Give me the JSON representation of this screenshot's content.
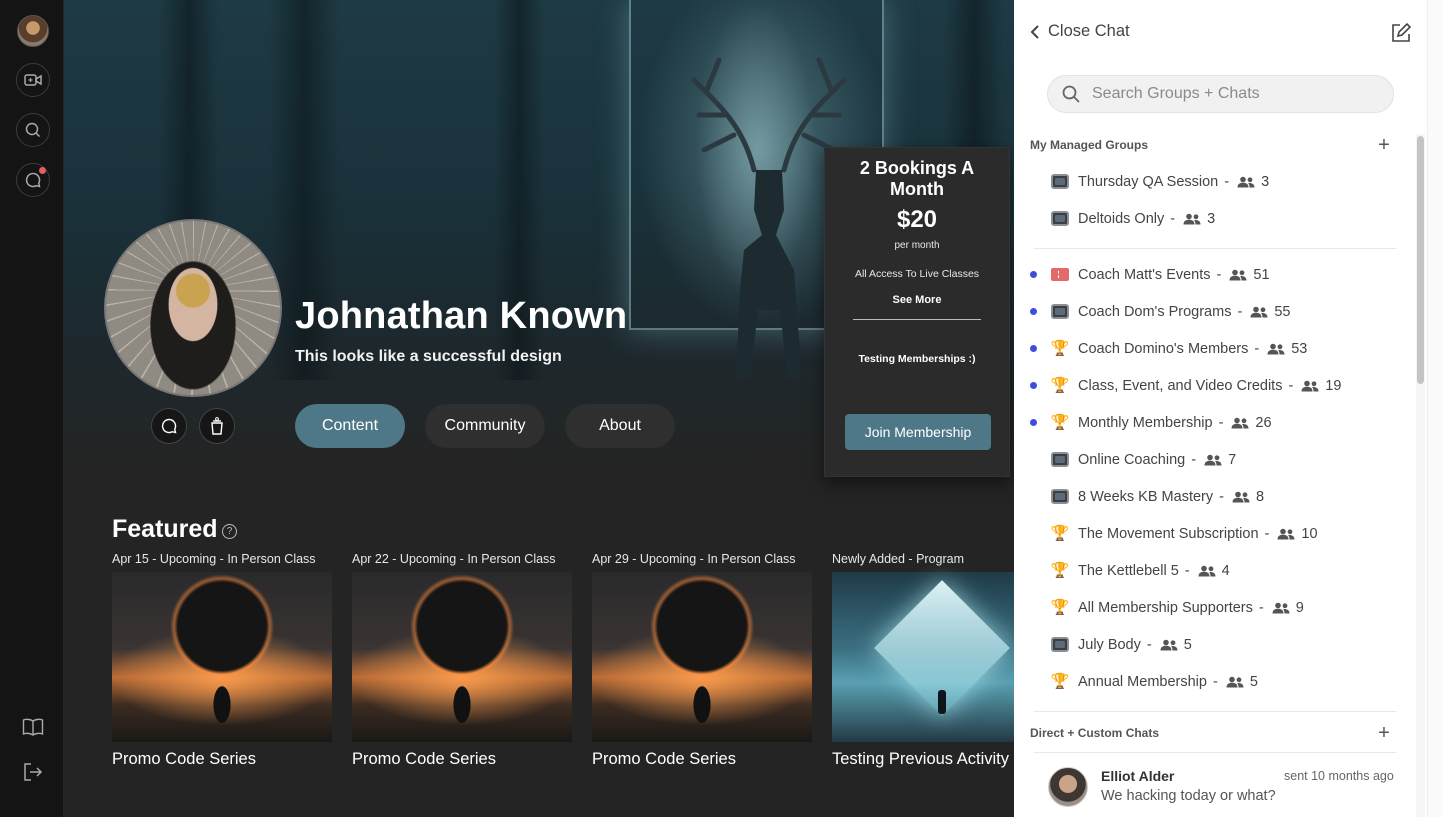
{
  "rail": {
    "icons": [
      "avatar",
      "video-icon",
      "search-icon",
      "chat-icon",
      "book-icon",
      "logout-icon"
    ]
  },
  "profile": {
    "name": "Johnathan Known",
    "tagline": "This looks like a successful design"
  },
  "tabs": [
    {
      "label": "Content",
      "active": true
    },
    {
      "label": "Community",
      "active": false
    },
    {
      "label": "About",
      "active": false
    }
  ],
  "membership": {
    "title": "2 Bookings A Month",
    "price": "$20",
    "period": "per month",
    "access": "All Access To Live Classes",
    "see_more": "See More",
    "note": "Testing Memberships :)",
    "join": "Join Membership"
  },
  "featured": {
    "title": "Featured",
    "cards": [
      {
        "meta": "Apr 15 - Upcoming - In Person Class",
        "title": "Promo Code Series",
        "image": "eclipse"
      },
      {
        "meta": "Apr 22 - Upcoming - In Person Class",
        "title": "Promo Code Series",
        "image": "eclipse"
      },
      {
        "meta": "Apr 29 - Upcoming - In Person Class",
        "title": "Promo Code Series",
        "image": "eclipse"
      },
      {
        "meta": "Newly Added - Program",
        "title": "Testing Previous Activity",
        "image": "cube"
      }
    ]
  },
  "chat": {
    "close_label": "Close Chat",
    "search_placeholder": "Search Groups + Chats",
    "managed_title": "My Managed Groups",
    "managed_groups": [
      {
        "name": "Thursday QA Session",
        "count": "3",
        "icon": "tv-icon",
        "unread": false
      },
      {
        "name": "Deltoids Only ",
        "count": "3",
        "icon": "tv-icon",
        "unread": false
      }
    ],
    "groups": [
      {
        "name": "Coach Matt's Events",
        "count": "51",
        "icon": "ticket-icon",
        "unread": true
      },
      {
        "name": "Coach Dom's Programs",
        "count": "55",
        "icon": "tv-icon",
        "unread": true
      },
      {
        "name": "Coach Domino's Members",
        "count": "53",
        "icon": "trophy-icon",
        "unread": true
      },
      {
        "name": "Class, Event, and Video Credits",
        "count": "19",
        "icon": "trophy-icon",
        "unread": true
      },
      {
        "name": "Monthly Membership",
        "count": "26",
        "icon": "trophy-icon",
        "unread": true
      },
      {
        "name": "Online Coaching",
        "count": "7",
        "icon": "tv-icon",
        "unread": false
      },
      {
        "name": "8 Weeks KB Mastery",
        "count": "8",
        "icon": "tv-icon",
        "unread": false
      },
      {
        "name": "The Movement Subscription",
        "count": "10",
        "icon": "trophy-icon",
        "unread": false
      },
      {
        "name": "The Kettlebell 5",
        "count": "4",
        "icon": "trophy-icon",
        "unread": false
      },
      {
        "name": "All Membership Supporters",
        "count": "9",
        "icon": "trophy-icon",
        "unread": false
      },
      {
        "name": "July Body",
        "count": "5",
        "icon": "tv-icon",
        "unread": false
      },
      {
        "name": "Annual Membership",
        "count": "5",
        "icon": "trophy-icon",
        "unread": false
      }
    ],
    "direct_title": "Direct + Custom Chats",
    "direct": [
      {
        "name": "Elliot Alder",
        "time": "sent 10 months ago",
        "message": "We hacking today or what?"
      }
    ]
  },
  "colors": {
    "accent": "#4e7888",
    "unread": "#3d4ed8",
    "trophy": "#d99a17"
  }
}
